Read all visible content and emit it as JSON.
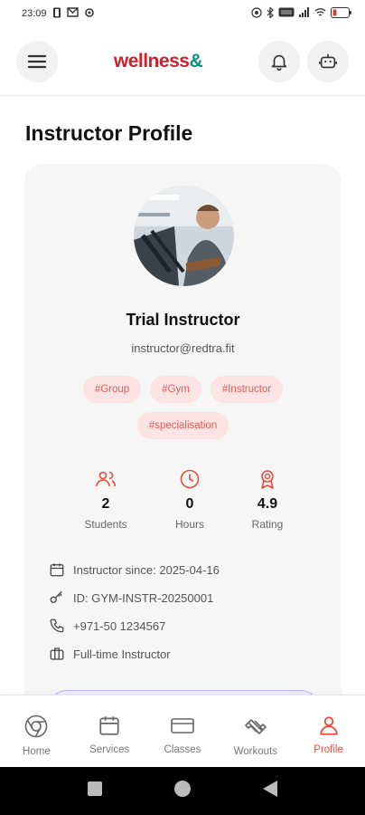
{
  "status_bar": {
    "time": "23:09"
  },
  "header": {
    "logo_main": "wellness",
    "logo_amp": "&"
  },
  "page_title": "Instructor Profile",
  "profile": {
    "name": "Trial Instructor",
    "email": "instructor@redtra.fit",
    "tags": [
      "#Group",
      "#Gym",
      "#Instructor",
      "#specialisation"
    ],
    "stats": [
      {
        "value": "2",
        "label": "Students",
        "icon": "users-icon"
      },
      {
        "value": "0",
        "label": "Hours",
        "icon": "clock-icon"
      },
      {
        "value": "4.9",
        "label": "Rating",
        "icon": "award-icon"
      }
    ],
    "details": [
      {
        "icon": "calendar-icon",
        "text": "Instructor since: 2025-04-16"
      },
      {
        "icon": "key-icon",
        "text": "ID: GYM-INSTR-20250001"
      },
      {
        "icon": "phone-icon",
        "text": "+971-50 1234567"
      },
      {
        "icon": "briefcase-icon",
        "text": "Full-time Instructor"
      }
    ]
  },
  "bottom_nav": {
    "items": [
      {
        "label": "Home",
        "icon": "home-icon"
      },
      {
        "label": "Services",
        "icon": "calendar-icon"
      },
      {
        "label": "Classes",
        "icon": "card-icon"
      },
      {
        "label": "Workouts",
        "icon": "dumbbell-icon"
      },
      {
        "label": "Profile",
        "icon": "user-icon",
        "active": true
      }
    ]
  },
  "colors": {
    "accent": "#e74c3c",
    "brand_red": "#d0202a",
    "brand_teal": "#0c8c7c",
    "tag_bg": "#fde4e4"
  }
}
